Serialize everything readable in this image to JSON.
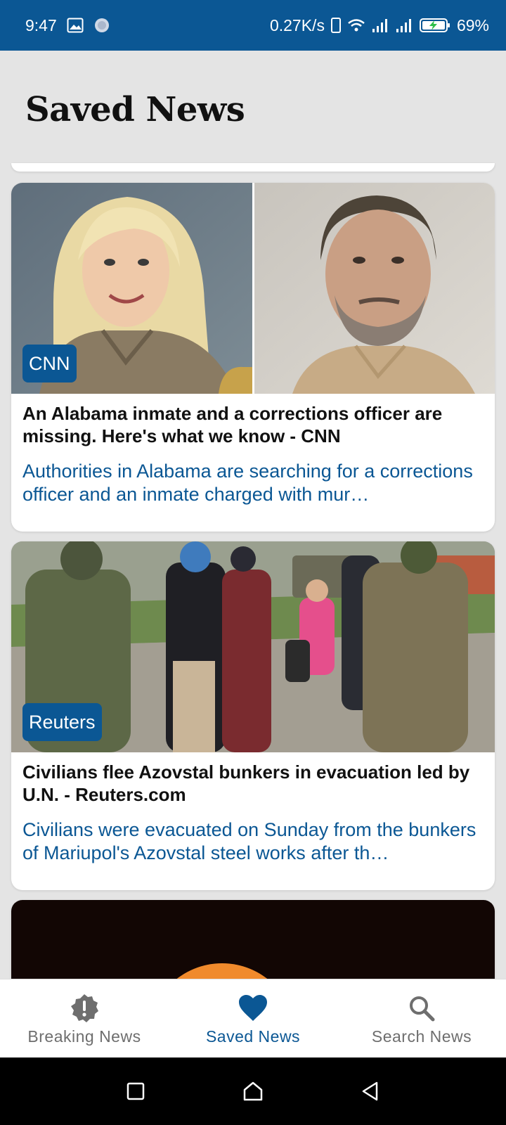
{
  "status_bar": {
    "time": "9:47",
    "net_speed": "0.27K/s",
    "battery": "69%",
    "icons": [
      "image-icon",
      "loading-icon",
      "phone-icon",
      "wifi-icon",
      "signal-icon",
      "signal-icon",
      "battery-charging-icon"
    ]
  },
  "page": {
    "title": "Saved News"
  },
  "articles": [
    {
      "source": "CNN",
      "title": "An Alabama inmate and a corrections officer are missing. Here's what we know - CNN",
      "description": "Authorities in Alabama are searching for a corrections officer and an inmate charged with mur…"
    },
    {
      "source": "Reuters",
      "title": "Civilians flee Azovstal bunkers in evacuation led by U.N. - Reuters.com",
      "description": "Civilians were evacuated on Sunday from the bunkers of Mariupol's Azovstal steel works after th…"
    }
  ],
  "bottom_nav": {
    "items": [
      {
        "label": "Breaking News",
        "icon": "alert-badge-icon",
        "active": false
      },
      {
        "label": "Saved News",
        "icon": "heart-icon",
        "active": true
      },
      {
        "label": "Search News",
        "icon": "search-icon",
        "active": false
      }
    ]
  },
  "system_nav": {
    "icons": [
      "recents-icon",
      "home-icon",
      "back-icon"
    ]
  },
  "colors": {
    "primary": "#0b5794",
    "background": "#e4e4e4",
    "inactive": "#6e6e6e"
  }
}
